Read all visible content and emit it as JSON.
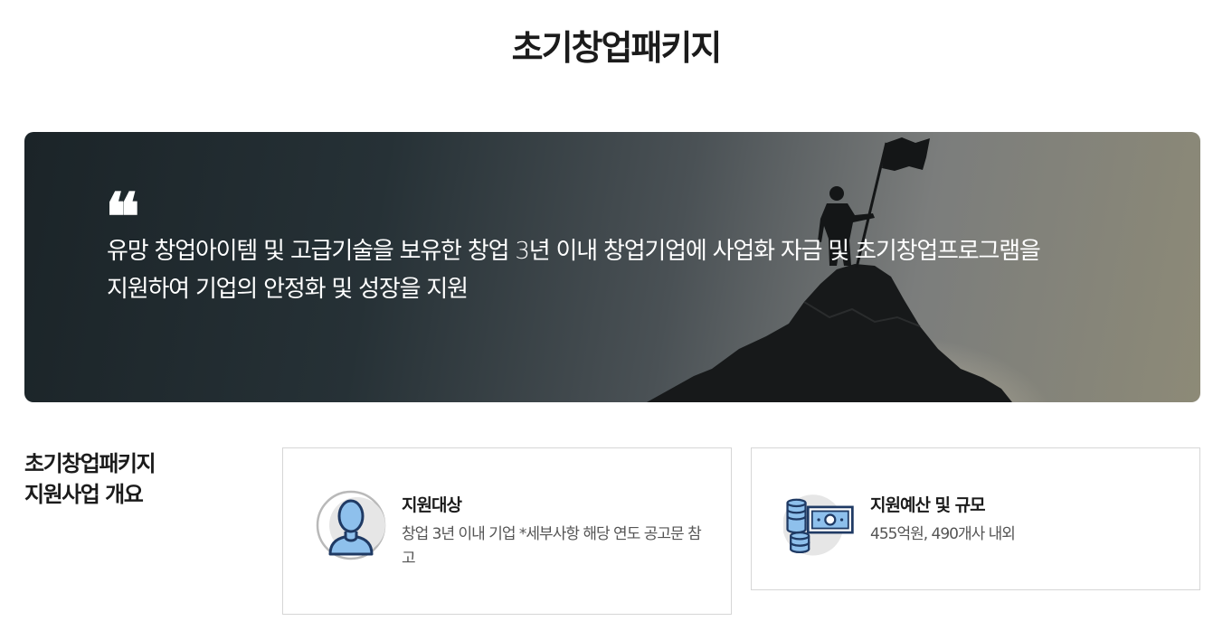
{
  "page": {
    "title": "초기창업패키지"
  },
  "hero": {
    "quote_mark": "66",
    "lines": [
      "유망 창업아이템 및 고급기술을 보유한 창업 3년 이내 창업기업에 사업화 자금 및 초기창업프로그램을",
      "지원하여 기업의 안정화 및 성장을 지원"
    ]
  },
  "overview": {
    "heading_lines": [
      "초기창업패키지",
      "지원사업 개요"
    ],
    "cards": [
      {
        "title": "지원대상",
        "description": "창업 3년 이내 기업 *세부사항 해당 연도 공고문 참고",
        "icon": "person-icon"
      },
      {
        "title": "지원예산 및 규모",
        "description": "455억원, 490개사 내외",
        "icon": "money-coins-icon"
      }
    ]
  },
  "colors": {
    "icon_navy": "#1f3a64",
    "icon_blue": "#8ec0ec",
    "icon_circle": "#e6e6e6"
  }
}
